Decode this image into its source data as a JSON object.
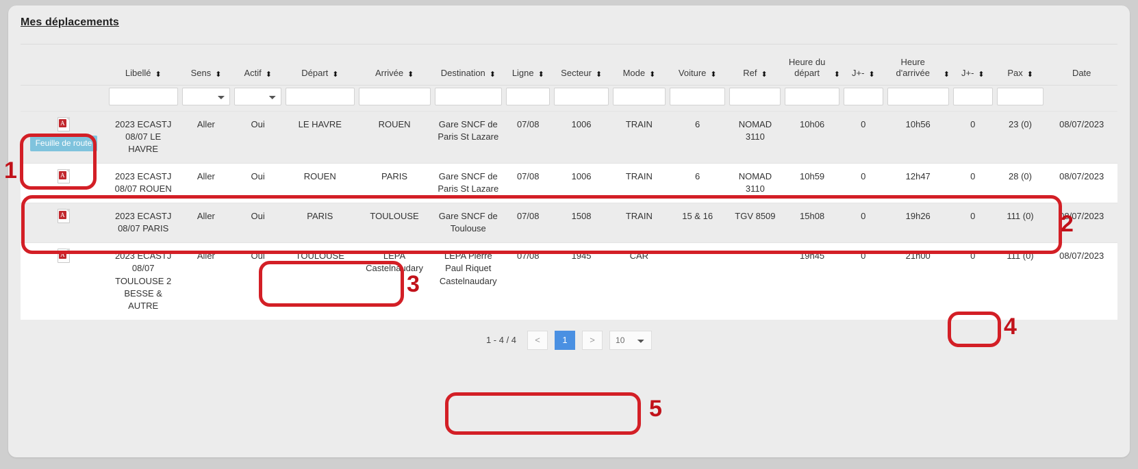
{
  "page": {
    "title": "Mes déplacements"
  },
  "columns": [
    {
      "label": "",
      "sortable": false,
      "filter": "none"
    },
    {
      "label": "Libellé",
      "sortable": true,
      "filter": "input"
    },
    {
      "label": "Sens",
      "sortable": true,
      "filter": "select"
    },
    {
      "label": "Actif",
      "sortable": true,
      "filter": "select"
    },
    {
      "label": "Départ",
      "sortable": true,
      "filter": "input"
    },
    {
      "label": "Arrivée",
      "sortable": true,
      "filter": "input"
    },
    {
      "label": "Destination",
      "sortable": true,
      "filter": "input"
    },
    {
      "label": "Ligne",
      "sortable": true,
      "filter": "input"
    },
    {
      "label": "Secteur",
      "sortable": true,
      "filter": "input"
    },
    {
      "label": "Mode",
      "sortable": true,
      "filter": "input"
    },
    {
      "label": "Voiture",
      "sortable": true,
      "filter": "input"
    },
    {
      "label": "Ref",
      "sortable": true,
      "filter": "input"
    },
    {
      "label": "Heure du départ",
      "sortable": true,
      "filter": "input"
    },
    {
      "label": "J+-",
      "sortable": true,
      "filter": "input"
    },
    {
      "label": "Heure d'arrivée",
      "sortable": true,
      "filter": "input"
    },
    {
      "label": "J+-",
      "sortable": true,
      "filter": "input"
    },
    {
      "label": "Pax",
      "sortable": true,
      "filter": "input"
    },
    {
      "label": "Date",
      "sortable": false,
      "filter": "none"
    }
  ],
  "filters": {
    "libelle": "",
    "sens": "",
    "actif": "",
    "depart": "",
    "arrivee": "",
    "destination": "",
    "ligne": "",
    "secteur": "",
    "mode": "",
    "voiture": "",
    "ref": "",
    "heure_depart": "",
    "jmoins1": "",
    "heure_arrivee": "",
    "jmoins2": "",
    "pax": ""
  },
  "rows": [
    {
      "doc_icon": "pdf-icon",
      "doc_tooltip": "Feuille de route",
      "libelle": "2023 ECASTJ 08/07 LE HAVRE",
      "sens": "Aller",
      "actif": "Oui",
      "depart": "LE HAVRE",
      "arrivee": "ROUEN",
      "destination": "Gare SNCF de Paris St Lazare",
      "ligne": "07/08",
      "secteur": "1006",
      "mode": "TRAIN",
      "voiture": "6",
      "ref": "NOMAD 3110",
      "heure_depart": "10h06",
      "jplus_depart": "0",
      "heure_arrivee": "10h56",
      "jplus_arrivee": "0",
      "pax": "23 (0)",
      "date": "08/07/2023"
    },
    {
      "doc_icon": "pdf-icon",
      "doc_tooltip": "",
      "libelle": "2023 ECASTJ 08/07 ROUEN",
      "sens": "Aller",
      "actif": "Oui",
      "depart": "ROUEN",
      "arrivee": "PARIS",
      "destination": "Gare SNCF de Paris St Lazare",
      "ligne": "07/08",
      "secteur": "1006",
      "mode": "TRAIN",
      "voiture": "6",
      "ref": "NOMAD 3110",
      "heure_depart": "10h59",
      "jplus_depart": "0",
      "heure_arrivee": "12h47",
      "jplus_arrivee": "0",
      "pax": "28 (0)",
      "date": "08/07/2023"
    },
    {
      "doc_icon": "pdf-icon",
      "doc_tooltip": "",
      "libelle": "2023 ECASTJ 08/07 PARIS",
      "sens": "Aller",
      "actif": "Oui",
      "depart": "PARIS",
      "arrivee": "TOULOUSE",
      "destination": "Gare SNCF de Toulouse",
      "ligne": "07/08",
      "secteur": "1508",
      "mode": "TRAIN",
      "voiture": "15 & 16",
      "ref": "TGV 8509",
      "heure_depart": "15h08",
      "jplus_depart": "0",
      "heure_arrivee": "19h26",
      "jplus_arrivee": "0",
      "pax": "111 (0)",
      "date": "08/07/2023"
    },
    {
      "doc_icon": "pdf-icon",
      "doc_tooltip": "",
      "libelle": "2023 ECASTJ 08/07 TOULOUSE 2 BESSE & AUTRE",
      "sens": "Aller",
      "actif": "Oui",
      "depart": "TOULOUSE",
      "arrivee": "LEPA Castelnaudary",
      "destination": "LEPA Pierre Paul Riquet Castelnaudary",
      "ligne": "07/08",
      "secteur": "1945",
      "mode": "CAR",
      "voiture": "",
      "ref": "",
      "heure_depart": "19h45",
      "jplus_depart": "0",
      "heure_arrivee": "21h00",
      "jplus_arrivee": "0",
      "pax": "111 (0)",
      "date": "08/07/2023"
    }
  ],
  "pagination": {
    "range_label": "1 - 4 / 4",
    "prev_label": "<",
    "next_label": ">",
    "current_page": "1",
    "page_size": "10"
  },
  "annotations": [
    {
      "number": "1"
    },
    {
      "number": "2"
    },
    {
      "number": "3"
    },
    {
      "number": "4"
    },
    {
      "number": "5"
    }
  ],
  "colors": {
    "annotation_red": "#d31f26",
    "link_blue": "#7d9cd2",
    "active_page_blue": "#4a90e2",
    "tooltip_blue": "#7fc3dd",
    "panel_bg": "#ececec"
  }
}
